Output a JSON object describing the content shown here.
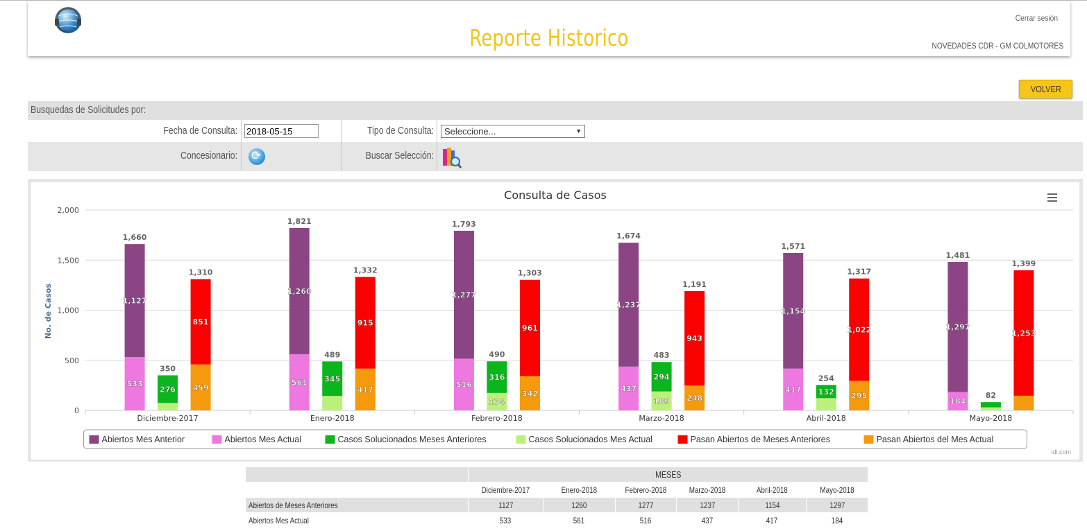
{
  "header": {
    "title": "Reporte Historico",
    "logout_label": "Cerrar sesión",
    "company": "NOVEDADES CDR  - GM COLMOTORES"
  },
  "volver_label": "VOLVER",
  "search": {
    "section_title": "Busquedas de Solicitudes por:",
    "fecha_label": "Fecha de Consulta:",
    "fecha_value": "2018-05-15",
    "tipo_label": "Tipo de Consulta:",
    "tipo_selected": "Seleccione...",
    "concesionario_label": "Concesionario:",
    "buscar_label": "Buscar Selección:"
  },
  "chart_data": {
    "type": "bar",
    "title": "Consulta de Casos",
    "ylabel": "No. de Casos",
    "xlabel": "",
    "ylim": [
      0,
      2000
    ],
    "yticks": [
      0,
      500,
      1000,
      1500,
      2000
    ],
    "ytick_labels": [
      "0",
      "500",
      "1,000",
      "1,500",
      "2,000"
    ],
    "grid": true,
    "legend_position": "bottom",
    "credit": "idl.com",
    "categories": [
      "Diciembre-2017",
      "Enero-2018",
      "Febrero-2018",
      "Marzo-2018",
      "Abril-2018",
      "Mayo-2018"
    ],
    "stacks": [
      {
        "name": "abiertos",
        "totals": [
          1660,
          1821,
          1793,
          1674,
          1571,
          1481
        ],
        "total_labels": [
          "1,660",
          "1,821",
          "1,793",
          "1,674",
          "1,571",
          "1,481"
        ]
      },
      {
        "name": "solucionados",
        "totals": [
          350,
          489,
          490,
          483,
          254,
          82
        ],
        "total_labels": [
          "350",
          "489",
          "490",
          "483",
          "254",
          "82"
        ]
      },
      {
        "name": "pasan",
        "totals": [
          1310,
          1332,
          1303,
          1191,
          1317,
          1399
        ],
        "total_labels": [
          "1,310",
          "1,332",
          "1,303",
          "1,191",
          "1,317",
          "1,399"
        ]
      }
    ],
    "series": [
      {
        "name": "Abiertos Mes Anterior",
        "stack": 0,
        "color": "#8b4585",
        "values": [
          1127,
          1260,
          1277,
          1237,
          1154,
          1297
        ],
        "labels": [
          "1,127",
          "1,260",
          "1,277",
          "1,237",
          "1,154",
          "1,297"
        ]
      },
      {
        "name": "Abiertos Mes Actual",
        "stack": 0,
        "color": "#ee77e0",
        "values": [
          533,
          561,
          516,
          437,
          417,
          184
        ],
        "labels": [
          "533",
          "561",
          "516",
          "437",
          "417",
          "184"
        ]
      },
      {
        "name": "Casos Solucionados Meses Anteriores",
        "stack": 1,
        "color": "#0cb51d",
        "values": [
          276,
          345,
          316,
          294,
          132,
          52
        ],
        "labels": [
          "276",
          "345",
          "316",
          "294",
          "132",
          ""
        ]
      },
      {
        "name": "Casos Solucionados Mes Actual",
        "stack": 1,
        "color": "#bdf07a",
        "values": [
          74,
          144,
          174,
          189,
          122,
          30
        ],
        "labels": [
          "",
          "",
          "174",
          "189",
          "",
          ""
        ]
      },
      {
        "name": "Pasan Abiertos de Meses Anteriores",
        "stack": 2,
        "color": "#fb0000",
        "values": [
          851,
          915,
          961,
          943,
          1022,
          1253
        ],
        "labels": [
          "851",
          "915",
          "961",
          "943",
          "1,022",
          "1,253"
        ]
      },
      {
        "name": "Pasan Abiertos del Mes Actual",
        "stack": 2,
        "color": "#f59a0c",
        "values": [
          459,
          417,
          342,
          248,
          295,
          146
        ],
        "labels": [
          "459",
          "417",
          "342",
          "248",
          "295",
          ""
        ]
      }
    ]
  },
  "table": {
    "group_header": "MESES",
    "months": [
      "Diciembre-2017",
      "Enero-2018",
      "Febrero-2018",
      "Marzo-2018",
      "Abril-2018",
      "Mayo-2018"
    ],
    "rows": [
      {
        "label": "Abiertos de Meses Anteriores",
        "values": [
          "1127",
          "1260",
          "1277",
          "1237",
          "1154",
          "1297"
        ]
      },
      {
        "label": "Abiertos Mes Actual",
        "values": [
          "533",
          "561",
          "516",
          "437",
          "417",
          "184"
        ]
      }
    ]
  }
}
